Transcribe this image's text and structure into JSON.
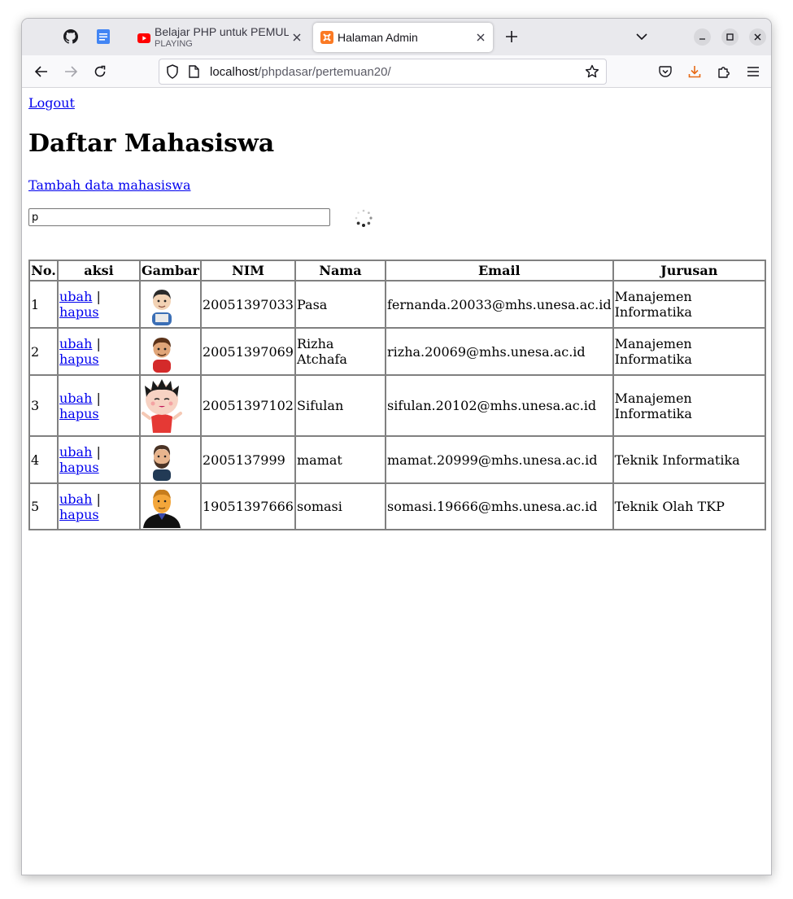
{
  "browser": {
    "tabs": [
      {
        "title": "Belajar PHP untuk PEMULA",
        "subtitle": "PLAYING",
        "favicon": "youtube-icon"
      },
      {
        "title": "Halaman Admin",
        "favicon": "xampp-icon"
      }
    ],
    "url_host": "localhost",
    "url_path": "/phpdasar/pertemuan20/"
  },
  "page": {
    "logout": "Logout",
    "title": "Daftar Mahasiswa",
    "add_link": "Tambah data mahasiswa",
    "search_value": "p"
  },
  "table": {
    "headers": [
      "No.",
      "aksi",
      "Gambar",
      "NIM",
      "Nama",
      "Email",
      "Jurusan"
    ],
    "edit_label": "ubah",
    "delete_label": "hapus",
    "separator": " |",
    "rows": [
      {
        "no": "1",
        "nim": "20051397033",
        "nama": "Pasa",
        "email": "fernanda.20033@mhs.unesa.ac.id",
        "jurusan": "Manajemen Informatika"
      },
      {
        "no": "2",
        "nim": "20051397069",
        "nama": "Rizha Atchafa",
        "email": "rizha.20069@mhs.unesa.ac.id",
        "jurusan": "Manajemen Informatika"
      },
      {
        "no": "3",
        "nim": "20051397102",
        "nama": "Sifulan",
        "email": "sifulan.20102@mhs.unesa.ac.id",
        "jurusan": "Manajemen Informatika"
      },
      {
        "no": "4",
        "nim": "2005137999",
        "nama": "mamat",
        "email": "mamat.20999@mhs.unesa.ac.id",
        "jurusan": "Teknik Informatika"
      },
      {
        "no": "5",
        "nim": "19051397666",
        "nama": "somasi",
        "email": "somasi.19666@mhs.unesa.ac.id",
        "jurusan": "Teknik Olah TKP"
      }
    ]
  },
  "colors": {
    "link": "#0000ee",
    "tabbar_bg": "#e9e9ed",
    "download_accent": "#e66a17"
  }
}
